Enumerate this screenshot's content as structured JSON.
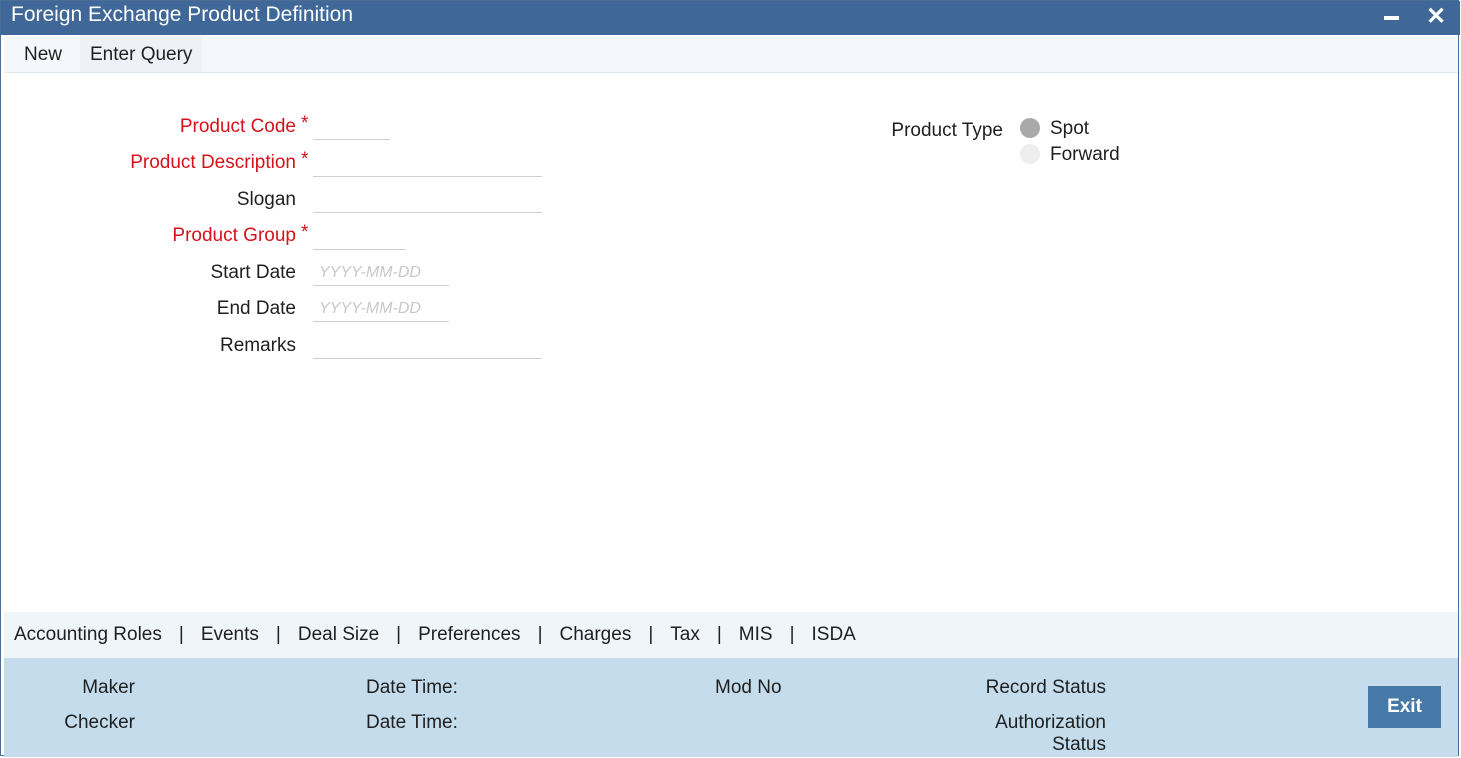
{
  "window": {
    "title": "Foreign Exchange Product Definition",
    "minimize_glyph": "minimize-icon",
    "close_glyph": "✕"
  },
  "menu": {
    "new_label": "New",
    "enter_query_label": "Enter Query"
  },
  "form": {
    "product_code": {
      "label": "Product Code",
      "required": "*",
      "value": ""
    },
    "product_description": {
      "label": "Product Description",
      "required": "*",
      "value": ""
    },
    "slogan": {
      "label": "Slogan",
      "value": ""
    },
    "product_group": {
      "label": "Product Group",
      "required": "*",
      "value": ""
    },
    "start_date": {
      "label": "Start Date",
      "placeholder": "YYYY-MM-DD",
      "value": ""
    },
    "end_date": {
      "label": "End Date",
      "placeholder": "YYYY-MM-DD",
      "value": ""
    },
    "remarks": {
      "label": "Remarks",
      "value": ""
    },
    "product_type": {
      "label": "Product Type",
      "options": [
        "Spot",
        "Forward"
      ],
      "selected": "Spot"
    }
  },
  "tabs": [
    "Accounting Roles",
    "Events",
    "Deal Size",
    "Preferences",
    "Charges",
    "Tax",
    "MIS",
    "ISDA"
  ],
  "tab_separator": "|",
  "footer": {
    "maker_label": "Maker",
    "checker_label": "Checker",
    "date_time_label": "Date Time:",
    "mod_no_label": "Mod No",
    "record_status_label": "Record Status",
    "authorization_label_line1": "Authorization",
    "authorization_label_line2": "Status",
    "exit_label": "Exit"
  },
  "colors": {
    "title_bar": "#3f6798",
    "required_label": "#d5121a",
    "footer_bg": "#c4dcec",
    "exit_button": "#4679a8"
  }
}
